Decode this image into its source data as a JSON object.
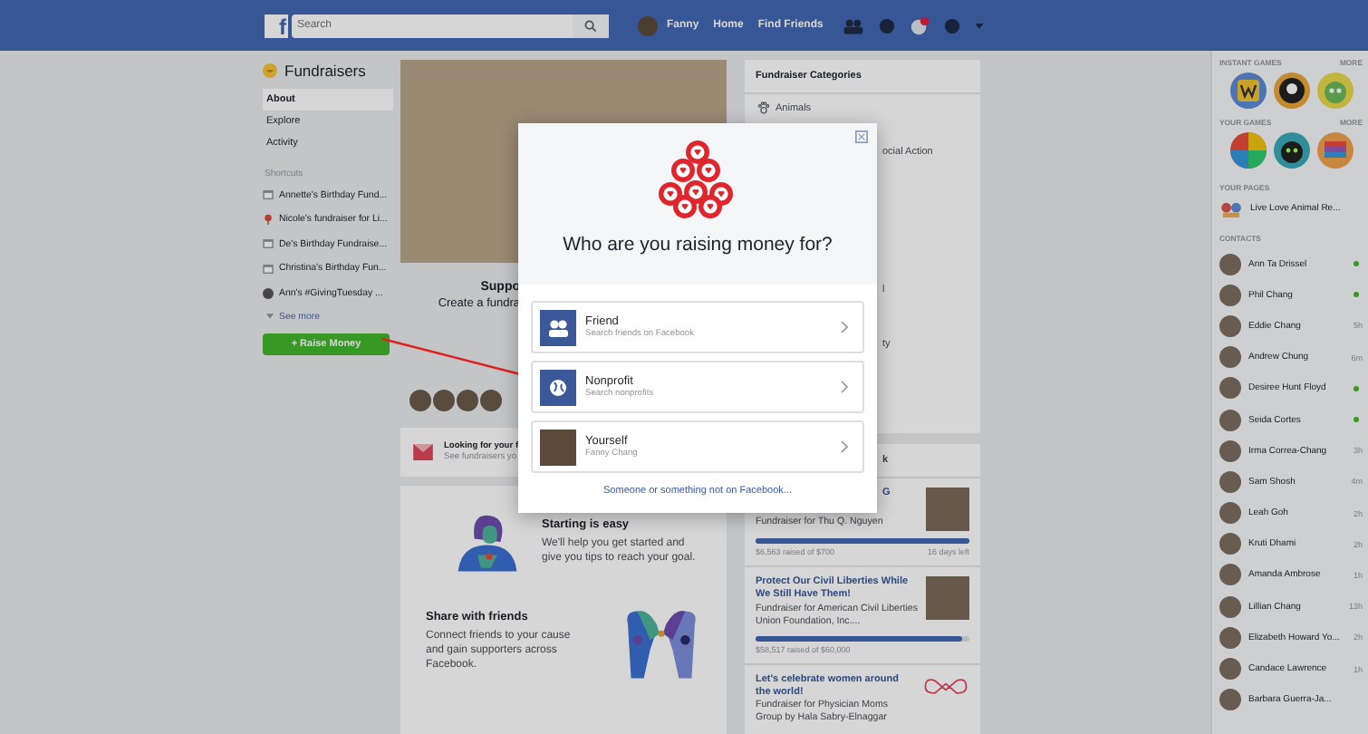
{
  "top_bar": {
    "logo": "f",
    "search": {
      "placeholder": "Search"
    },
    "user": "Fanny",
    "links": [
      "Home",
      "Find Friends"
    ]
  },
  "left_nav": {
    "title": "Fundraisers",
    "items": [
      {
        "label": "About",
        "selected": true
      },
      {
        "label": "Explore",
        "selected": false
      },
      {
        "label": "Activity",
        "selected": false
      }
    ],
    "shortcuts_heading": "Shortcuts",
    "shortcuts": [
      {
        "label": "Annette's Birthday Fund...",
        "kind": "calendar"
      },
      {
        "label": "Nicole's fundraiser for Li...",
        "kind": "pin"
      },
      {
        "label": "De's Birthday Fundraise...",
        "kind": "calendar"
      },
      {
        "label": "Christina's Birthday Fun...",
        "kind": "calendar"
      },
      {
        "label": "Ann's #GivingTuesday ...",
        "kind": "avatar"
      }
    ],
    "see_more": "See more",
    "raise_button": "+ Raise Money"
  },
  "middle": {
    "hero_title": "Suppo",
    "hero_text": "Create a fundra",
    "notice": {
      "title": "Looking for your f",
      "text": "See fundraisers yo"
    },
    "tips": [
      {
        "title": "Starting is easy",
        "text": "We'll help you get started and give you tips to reach your goal."
      },
      {
        "title": "Share with friends",
        "text": "Connect friends to your cause and gain supporters across Facebook."
      }
    ]
  },
  "categories": {
    "title": "Fundraiser Categories",
    "items": [
      "Animals",
      "ocial Action",
      "l",
      "ty"
    ]
  },
  "fundraisers": {
    "title": "k",
    "items": [
      {
        "title": "G",
        "subtitle": "Fundraiser for Thu Q. Nguyen",
        "level": 1,
        "raised": "$6,563 raised of $700",
        "days_left": "16 days left"
      },
      {
        "title": "Protect Our Civil Liberties While We Still Have Them!",
        "subtitle": "Fundraiser for American Civil Liberties Union Foundation, Inc....",
        "level": 0.97,
        "raised": "$58,517 raised of $60,000"
      },
      {
        "title": "Let's celebrate women around the world!",
        "subtitle": "Fundraiser for Physician Moms Group by Hala Sabry-Elnaggar"
      }
    ]
  },
  "chat_sidebar": {
    "instant_games": "INSTANT GAMES",
    "your_games": "YOUR GAMES",
    "instant_games_more": "MORE",
    "your_games_more": "MORE",
    "your_pages": "YOUR PAGES",
    "page": "Live Love Animal Re...",
    "contacts_heading": "CONTACTS",
    "contacts": [
      {
        "name": "Ann Ta Drissel",
        "online": true
      },
      {
        "name": "Phil Chang",
        "online": true
      },
      {
        "name": "Eddie Chang",
        "online": false,
        "time": "5h"
      },
      {
        "name": "Andrew Chung",
        "online": false,
        "time": "6m"
      },
      {
        "name": "Desiree Hunt Floyd",
        "online": true
      },
      {
        "name": "Seida Cortes",
        "online": true
      },
      {
        "name": "Irma Correa-Chang",
        "online": false,
        "time": "3h"
      },
      {
        "name": "Sam Shosh",
        "online": false,
        "time": "4m"
      },
      {
        "name": "Leah Goh",
        "online": false,
        "time": "2h"
      },
      {
        "name": "Kruti Dhami",
        "online": false,
        "time": "2h"
      },
      {
        "name": "Amanda Ambrose",
        "online": false,
        "time": "1h"
      },
      {
        "name": "Lillian Chang",
        "online": false,
        "time": "13h"
      },
      {
        "name": "Elizabeth Howard Yo...",
        "online": false,
        "time": "2h"
      },
      {
        "name": "Candace Lawrence",
        "online": false,
        "time": "1h"
      },
      {
        "name": "Barbara Guerra-Ja...",
        "online": false
      }
    ]
  },
  "modal": {
    "title": "Who are you raising money for?",
    "options": [
      {
        "title": "Friend",
        "subtitle": "Search friends on Facebook",
        "kind": "friends"
      },
      {
        "title": "Nonprofit",
        "subtitle": "Search nonprofits",
        "kind": "globe"
      },
      {
        "title": "Yourself",
        "subtitle": "Fanny Chang",
        "kind": "photo"
      }
    ],
    "link": "Someone or something not on Facebook..."
  }
}
